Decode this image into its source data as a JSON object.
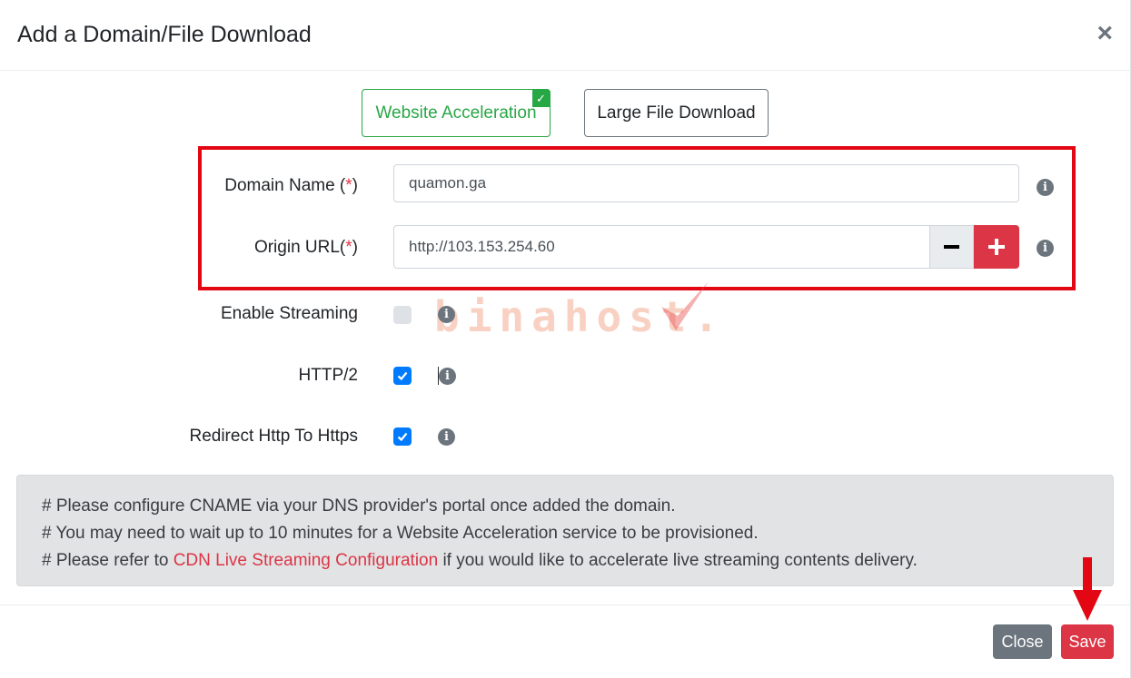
{
  "dialog": {
    "title": "Add a Domain/File Download",
    "close_symbol": "×"
  },
  "service_types": {
    "website_acceleration": "Website Acceleration",
    "large_file_download": "Large File Download",
    "selected_mark": "✓"
  },
  "form": {
    "domain_name": {
      "label": "Domain Name (",
      "required_mark": "*",
      "label_end": ")",
      "value": "quamon.ga"
    },
    "origin_url": {
      "label": "Origin URL(",
      "required_mark": "*",
      "label_end": ")",
      "value": "http://103.153.254.60"
    },
    "enable_streaming": {
      "label": "Enable Streaming",
      "checked": false
    },
    "http2": {
      "label": "HTTP/2",
      "checked": true
    },
    "redirect_https": {
      "label": "Redirect Http To Https",
      "checked": true
    },
    "info_glyph": "i"
  },
  "watermark": "binahost.",
  "note": {
    "line1": "# Please configure CNAME via your DNS provider's portal once added the domain.",
    "line2": "# You may need to wait up to 10 minutes for a Website Acceleration service to be provisioned.",
    "line3_prefix": "# Please refer to ",
    "line3_link": "CDN Live Streaming Configuration",
    "line3_suffix": " if you would like to accelerate live streaming contents delivery."
  },
  "footer": {
    "close_label": "Close",
    "save_label": "Save"
  },
  "colors": {
    "danger": "#dc3545",
    "success": "#28a745",
    "primary": "#007bff",
    "secondary": "#6c757d",
    "annotation": "#e30613"
  }
}
